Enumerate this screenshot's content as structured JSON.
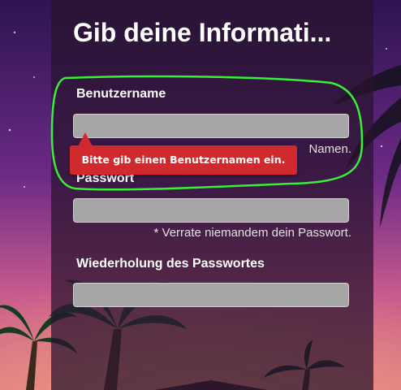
{
  "form": {
    "title": "Gib deine Informati...",
    "username": {
      "label": "Benutzername",
      "value": "",
      "hint": "Namen."
    },
    "password": {
      "label": "Passwort",
      "value": "",
      "hint": "* Verrate niemandem dein Passwort."
    },
    "password_repeat": {
      "label": "Wiederholung des Passwortes",
      "value": ""
    }
  },
  "tooltip": {
    "message": "Bitte gib einen Benutzernamen ein."
  },
  "colors": {
    "error": "#d12a2e",
    "highlight": "#38f03a",
    "input_bg": "#a6a6a6"
  }
}
